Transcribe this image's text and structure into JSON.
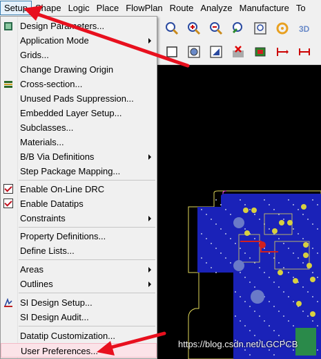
{
  "menubar": {
    "items": [
      "Setup",
      "Shape",
      "Logic",
      "Place",
      "FlowPlan",
      "Route",
      "Analyze",
      "Manufacture",
      "To"
    ]
  },
  "setup_menu": {
    "items": [
      {
        "label": "Design Parameters..."
      },
      {
        "label": "Application Mode"
      },
      {
        "label": "Grids..."
      },
      {
        "label": "Change Drawing Origin"
      },
      {
        "label": "Cross-section..."
      },
      {
        "label": "Unused Pads Suppression..."
      },
      {
        "label": "Embedded Layer Setup..."
      },
      {
        "label": "Subclasses..."
      },
      {
        "label": "Materials..."
      },
      {
        "label": "B/B Via Definitions"
      },
      {
        "label": "Step Package Mapping..."
      },
      {
        "label": "Enable On-Line DRC",
        "checked": true
      },
      {
        "label": "Enable Datatips",
        "checked": true
      },
      {
        "label": "Constraints"
      },
      {
        "label": "Property Definitions..."
      },
      {
        "label": "Define Lists..."
      },
      {
        "label": "Areas"
      },
      {
        "label": "Outlines"
      },
      {
        "label": "SI Design Setup..."
      },
      {
        "label": "SI Design Audit..."
      },
      {
        "label": "Datatip Customization..."
      },
      {
        "label": "User Preferences..."
      }
    ]
  },
  "canvas": {
    "watermark": "https://blog.csdn.net/LGCPCB"
  },
  "colors": {
    "pcb_board": "#1a22b8",
    "outline": "#e0d85a",
    "highlight": "#fbe3e8",
    "annotation": "#e8101e"
  }
}
